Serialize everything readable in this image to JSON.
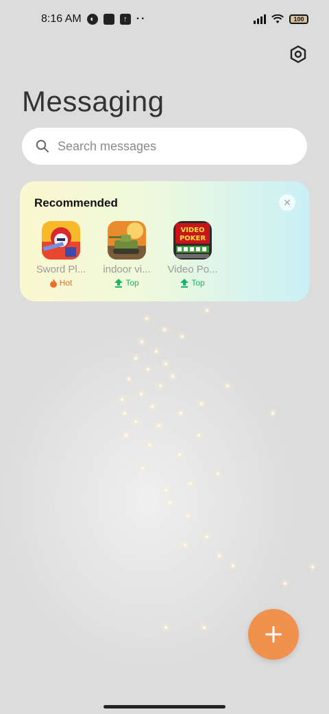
{
  "status_bar": {
    "time": "8:16 AM",
    "battery": "100",
    "icons": [
      "notification-icon",
      "square-icon",
      "upload-icon",
      "more-dots-icon",
      "signal-icon",
      "wifi-icon",
      "battery-icon"
    ]
  },
  "header": {
    "title": "Messaging",
    "settings_icon": "hexagon-gear-icon"
  },
  "search": {
    "placeholder": "Search messages",
    "icon": "search-icon"
  },
  "recommended": {
    "title": "Recommended",
    "close_icon": "close-icon",
    "apps": [
      {
        "name": "Sword Pl...",
        "badge": "Hot",
        "badge_type": "hot"
      },
      {
        "name": "indoor vi...",
        "badge": "Top",
        "badge_type": "top"
      },
      {
        "name": "Video Po...",
        "badge": "Top",
        "badge_type": "top"
      }
    ],
    "video_poker_icon_text": "VIDEO POKER"
  },
  "fab": {
    "icon": "plus-icon"
  },
  "colors": {
    "background": "#dcdcdc",
    "fab": "#f1914e",
    "hot": "#f06a26",
    "top": "#17b469"
  }
}
